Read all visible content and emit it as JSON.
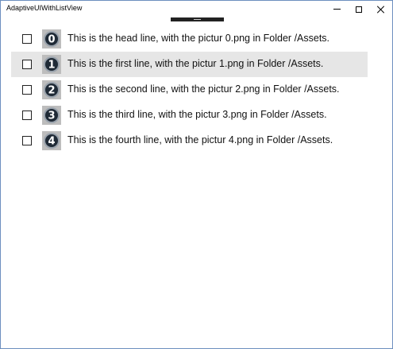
{
  "window": {
    "title": "AdaptiveUIWithListView",
    "controls": {
      "minimize": "minimize-icon",
      "maximize": "maximize-icon",
      "close": "close-icon"
    }
  },
  "list": {
    "items": [
      {
        "number": "0",
        "text": "This is the head line, with the pictur 0.png in Folder /Assets.",
        "selected": false,
        "checked": false
      },
      {
        "number": "1",
        "text": "This is the first line, with the pictur 1.png in Folder /Assets.",
        "selected": true,
        "checked": false
      },
      {
        "number": "2",
        "text": "This is the second line, with the pictur 2.png in Folder /Assets.",
        "selected": false,
        "checked": false
      },
      {
        "number": "3",
        "text": "This is the third line, with the pictur 3.png in Folder /Assets.",
        "selected": false,
        "checked": false
      },
      {
        "number": "4",
        "text": "This is the fourth line, with the pictur 4.png in Folder /Assets.",
        "selected": false,
        "checked": false
      }
    ]
  },
  "colors": {
    "selection": "#e6e6e6",
    "badge_dark": "#1f2a36",
    "badge_ring": "#9aa3ad",
    "thumb_bg": "#bdbdbd"
  }
}
